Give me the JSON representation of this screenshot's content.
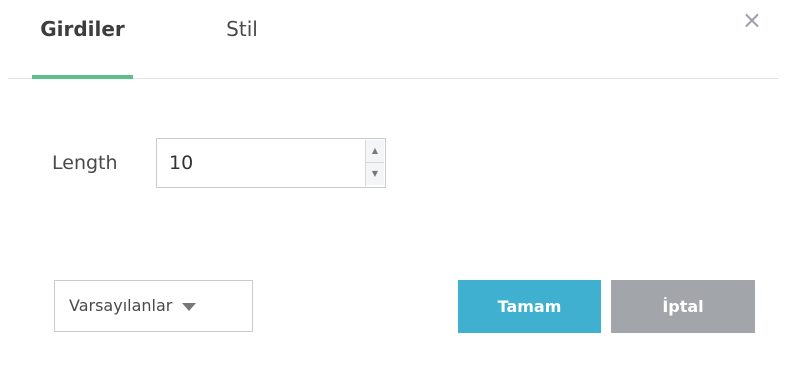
{
  "tabs": {
    "girdiler": "Girdiler",
    "stil": "Stil"
  },
  "close_symbol": "×",
  "fields": {
    "length_label": "Length",
    "length_value": "10"
  },
  "spinner": {
    "up": "▲",
    "down": "▼"
  },
  "buttons": {
    "defaults": "Varsayılanlar",
    "ok": "Tamam",
    "cancel": "İptal"
  },
  "colors": {
    "active_tab_indicator": "#5cbf8a",
    "ok_button": "#3fb0cf",
    "cancel_button": "#a2a5a9"
  }
}
